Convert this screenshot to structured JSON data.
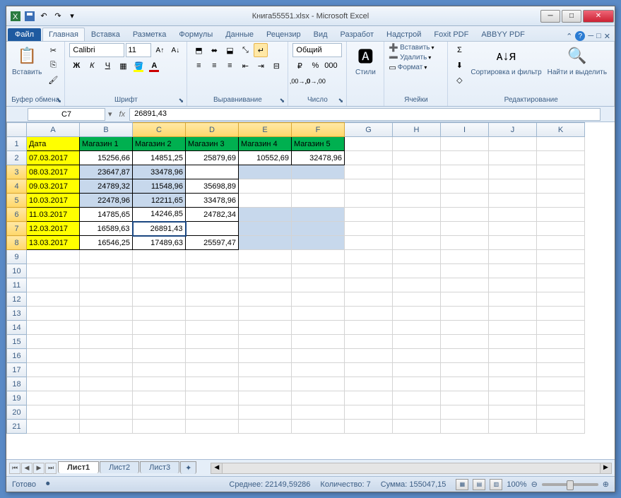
{
  "title": "Книга55551.xlsx - Microsoft Excel",
  "tabs": {
    "file": "Файл",
    "home": "Главная",
    "insert": "Вставка",
    "layout": "Разметка",
    "formulas": "Формулы",
    "data": "Данные",
    "review": "Рецензир",
    "view": "Вид",
    "dev": "Разработ",
    "addins": "Надстрой",
    "foxit": "Foxit PDF",
    "abbyy": "ABBYY PDF"
  },
  "ribbon": {
    "clipboard": {
      "paste": "Вставить",
      "label": "Буфер обмена"
    },
    "font": {
      "name": "Calibri",
      "size": "11",
      "label": "Шрифт"
    },
    "align": {
      "label": "Выравнивание"
    },
    "number": {
      "format": "Общий",
      "label": "Число"
    },
    "styles": {
      "btn": "Стили",
      "label": ""
    },
    "cells": {
      "insert": "Вставить",
      "delete": "Удалить",
      "format": "Формат",
      "label": "Ячейки"
    },
    "editing": {
      "sort": "Сортировка и фильтр",
      "find": "Найти и выделить",
      "label": "Редактирование"
    }
  },
  "namebox": "C7",
  "formula": "26891,43",
  "cols": [
    "A",
    "B",
    "C",
    "D",
    "E",
    "F",
    "G",
    "H",
    "I",
    "J",
    "K"
  ],
  "headers": {
    "A": "Дата",
    "B": "Магазин 1",
    "C": "Магазин 2",
    "D": "Магазин 3",
    "E": "Магазин 4",
    "F": "Магазин 5"
  },
  "rows": [
    {
      "n": 2,
      "A": "07.03.2017",
      "B": "15256,66",
      "C": "14851,25",
      "D": "25879,69",
      "E": "10552,69",
      "F": "32478,96"
    },
    {
      "n": 3,
      "A": "08.03.2017",
      "B": "23647,87",
      "C": "33478,96",
      "D": "",
      "E": "",
      "F": ""
    },
    {
      "n": 4,
      "A": "09.03.2017",
      "B": "24789,32",
      "C": "11548,96",
      "D": "35698,89",
      "E": "",
      "F": ""
    },
    {
      "n": 5,
      "A": "10.03.2017",
      "B": "22478,96",
      "C": "12211,65",
      "D": "33478,96",
      "E": "",
      "F": ""
    },
    {
      "n": 6,
      "A": "11.03.2017",
      "B": "14785,65",
      "C": "14246,85",
      "D": "24782,34",
      "E": "",
      "F": ""
    },
    {
      "n": 7,
      "A": "12.03.2017",
      "B": "16589,63",
      "C": "26891,43",
      "D": "",
      "E": "",
      "F": ""
    },
    {
      "n": 8,
      "A": "13.03.2017",
      "B": "16546,25",
      "C": "17489,63",
      "D": "25597,47",
      "E": "",
      "F": ""
    }
  ],
  "sheets": [
    "Лист1",
    "Лист2",
    "Лист3"
  ],
  "status": {
    "ready": "Готово",
    "avg": "Среднее: 22149,59286",
    "count": "Количество: 7",
    "sum": "Сумма: 155047,15",
    "zoom": "100%"
  }
}
